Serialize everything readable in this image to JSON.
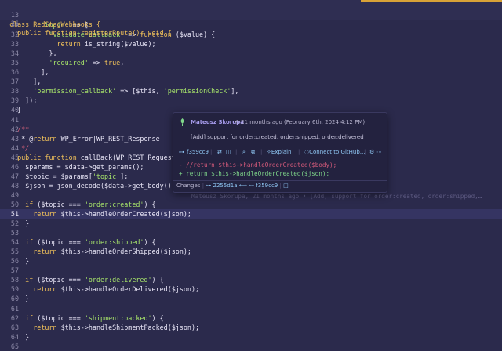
{
  "sticky": [
    {
      "ln": "13",
      "code": "class RedStagWebhooks {"
    },
    {
      "ln": "26",
      "code": "  public function registerRoute(): void {"
    }
  ],
  "lines": [
    {
      "ln": "31",
      "code": "        'topic' => ["
    },
    {
      "ln": "32",
      "code": "          'validate_callback' => function ($value) {"
    },
    {
      "ln": "33",
      "code": "            return is_string($value);"
    },
    {
      "ln": "34",
      "code": "          },"
    },
    {
      "ln": "35",
      "code": "          'required' => true,"
    },
    {
      "ln": "36",
      "code": "        ],"
    },
    {
      "ln": "37",
      "code": "      ],"
    },
    {
      "ln": "38",
      "code": "      'permission_callback' => [$this, 'permissionCheck'],"
    },
    {
      "ln": "39",
      "code": "    ]);"
    },
    {
      "ln": "40",
      "code": "  }"
    },
    {
      "ln": "41",
      "code": ""
    },
    {
      "ln": "42",
      "code": "  /**"
    },
    {
      "ln": "43",
      "code": "   * @return WP_Error|WP_REST_Response"
    },
    {
      "ln": "44",
      "code": "   */"
    },
    {
      "ln": "45",
      "code": "  public function callBack(WP_REST_Request $da"
    },
    {
      "ln": "46",
      "code": "    $params = $data->get_params();"
    },
    {
      "ln": "47",
      "code": "    $topic = $params['topic'];"
    },
    {
      "ln": "48",
      "code": "    $json = json_decode($data->get_body());"
    },
    {
      "ln": "49",
      "code": ""
    },
    {
      "ln": "50",
      "code": "    if ($topic === 'order:created') {"
    },
    {
      "ln": "51",
      "code": "      return $this->handleOrderCreated($json);"
    },
    {
      "ln": "52",
      "code": "    }"
    },
    {
      "ln": "53",
      "code": ""
    },
    {
      "ln": "54",
      "code": "    if ($topic === 'order:shipped') {"
    },
    {
      "ln": "55",
      "code": "      return $this->handleOrderShipped($json);"
    },
    {
      "ln": "56",
      "code": "    }"
    },
    {
      "ln": "57",
      "code": ""
    },
    {
      "ln": "58",
      "code": "    if ($topic === 'order:delivered') {"
    },
    {
      "ln": "59",
      "code": "      return $this->handleOrderDelivered($json);"
    },
    {
      "ln": "60",
      "code": "    }"
    },
    {
      "ln": "61",
      "code": ""
    },
    {
      "ln": "62",
      "code": "    if ($topic === 'shipment:packed') {"
    },
    {
      "ln": "63",
      "code": "      return $this->handleShipmentPacked($json);"
    },
    {
      "ln": "64",
      "code": "    }"
    },
    {
      "ln": "65",
      "code": ""
    }
  ],
  "inline_blame": "Mateusz Skorupa, 21 months ago • [Add] support for order:created, order:shipped,…",
  "popup": {
    "author": "Mateusz Skorupa",
    "time": "21 months ago (February 6th, 2024 4:12 PM)",
    "message": "[Add] support for order:created, order:shipped, order:delivered",
    "commit": "f359cc9",
    "explain": "Explain",
    "connect": "Connect to GitHub…",
    "diff_removed": "- //return $this->handleOrderCreated($body);",
    "diff_added": "+ return $this->handleOrderCreated($json);",
    "changes_label": "Changes",
    "changes_from": "2255d1a",
    "changes_arrow": "⟷",
    "changes_to": "f359cc9"
  },
  "colors": {
    "background": "#2b2a4c",
    "keyword": "#f2c25a",
    "string": "#a6e36a",
    "comment": "#d4607a",
    "link": "#8fc6f3",
    "author": "#a99ef0"
  }
}
